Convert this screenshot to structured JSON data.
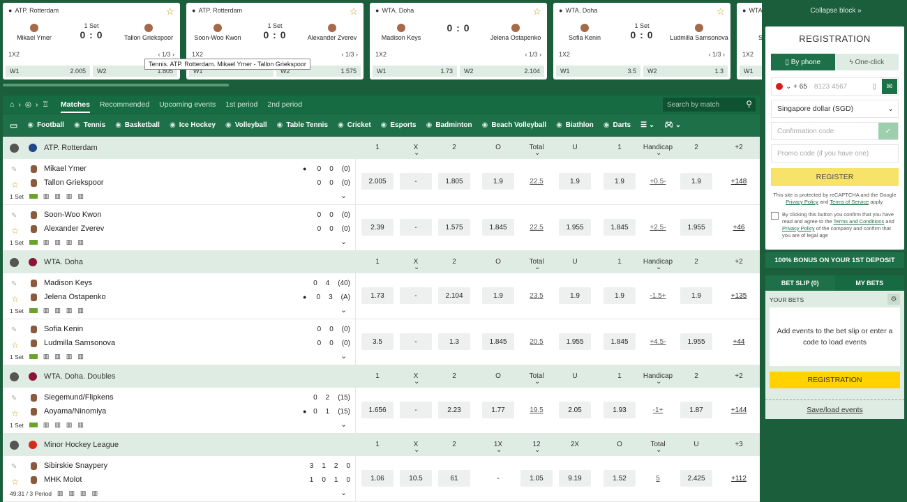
{
  "top_cards": [
    {
      "league": "ATP. Rotterdam",
      "team1": "Mikael Ymer",
      "team2": "Tallon Griekspoor",
      "set": "1 Set",
      "score": "0 : 0",
      "market": "1X2",
      "pager": "1/3",
      "w1": "W1",
      "o1": "2.005",
      "w2": "W2",
      "o2": "1.805"
    },
    {
      "league": "ATP. Rotterdam",
      "team1": "Soon-Woo Kwon",
      "team2": "Alexander Zverev",
      "set": "1 Set",
      "score": "0 : 0",
      "market": "1X2",
      "pager": "1/3",
      "w1": "W1",
      "o1": "",
      "w2": "W2",
      "o2": "1.575"
    },
    {
      "league": "WTA. Doha",
      "team1": "Madison Keys",
      "team2": "Jelena Ostapenko",
      "set": "",
      "score": "0 : 0",
      "market": "1X2",
      "pager": "1/3",
      "w1": "W1",
      "o1": "1.73",
      "w2": "W2",
      "o2": "2.104"
    },
    {
      "league": "WTA. Doha",
      "team1": "Sofia Kenin",
      "team2": "Ludmilla Samsonova",
      "set": "1 Set",
      "score": "0 : 0",
      "market": "1X2",
      "pager": "1/3",
      "w1": "W1",
      "o1": "3.5",
      "w2": "W2",
      "o2": "1.3"
    },
    {
      "league": "WTA",
      "team1": "Siegen",
      "team2": "",
      "set": "",
      "score": "",
      "market": "1X2",
      "pager": "",
      "w1": "W1",
      "o1": "",
      "w2": "",
      "o2": ""
    }
  ],
  "tooltip": "Tennis. ATP. Rotterdam. Mikael Ymer - Tallon Griekspoor",
  "nav": {
    "tabs": [
      "Matches",
      "Recommended",
      "Upcoming events",
      "1st period",
      "2nd period"
    ],
    "search_placeholder": "Search by match"
  },
  "sports": [
    "Football",
    "Tennis",
    "Basketball",
    "Ice Hockey",
    "Volleyball",
    "Table Tennis",
    "Cricket",
    "Esports",
    "Badminton",
    "Beach Volleyball",
    "Biathlon",
    "Darts"
  ],
  "leagues": [
    {
      "name": "ATP. Rotterdam",
      "flag_color": "#21468b",
      "cols": [
        "1",
        "X",
        "2",
        "O",
        "Total",
        "U",
        "1",
        "Handicap",
        "2",
        "+2"
      ],
      "matches": [
        {
          "t1": "Mikael Ymer",
          "t2": "Tallon Griekspoor",
          "s1": [
            "0",
            "0",
            "(0)"
          ],
          "s2": [
            "0",
            "0",
            "(0)"
          ],
          "serve": 1,
          "period": "1 Set",
          "odds": [
            "2.005",
            "-",
            "1.805",
            "1.9",
            "22.5",
            "1.9",
            "1.9",
            "+0.5-",
            "1.9"
          ],
          "more": "+148"
        },
        {
          "t1": "Soon-Woo Kwon",
          "t2": "Alexander Zverev",
          "s1": [
            "0",
            "0",
            "(0)"
          ],
          "s2": [
            "0",
            "0",
            "(0)"
          ],
          "serve": 0,
          "period": "1 Set",
          "odds": [
            "2.39",
            "-",
            "1.575",
            "1.845",
            "22.5",
            "1.955",
            "1.845",
            "+2.5-",
            "1.955"
          ],
          "more": "+46"
        }
      ]
    },
    {
      "name": "WTA. Doha",
      "flag_color": "#8a1538",
      "cols": [
        "1",
        "X",
        "2",
        "O",
        "Total",
        "U",
        "1",
        "Handicap",
        "2",
        "+2"
      ],
      "matches": [
        {
          "t1": "Madison Keys",
          "t2": "Jelena Ostapenko",
          "s1": [
            "0",
            "4",
            "(40)"
          ],
          "s2": [
            "0",
            "3",
            "(A)"
          ],
          "serve": 2,
          "period": "1 Set",
          "odds": [
            "1.73",
            "-",
            "2.104",
            "1.9",
            "23.5",
            "1.9",
            "1.9",
            "-1.5+",
            "1.9"
          ],
          "more": "+135"
        },
        {
          "t1": "Sofia Kenin",
          "t2": "Ludmilla Samsonova",
          "s1": [
            "0",
            "0",
            "(0)"
          ],
          "s2": [
            "0",
            "0",
            "(0)"
          ],
          "serve": 0,
          "period": "1 Set",
          "odds": [
            "3.5",
            "-",
            "1.3",
            "1.845",
            "20.5",
            "1.955",
            "1.845",
            "+4.5-",
            "1.955"
          ],
          "more": "+44"
        }
      ]
    },
    {
      "name": "WTA. Doha. Doubles",
      "flag_color": "#8a1538",
      "cols": [
        "1",
        "X",
        "2",
        "O",
        "Total",
        "U",
        "1",
        "Handicap",
        "2",
        "+2"
      ],
      "matches": [
        {
          "t1": "Siegemund/Flipkens",
          "t2": "Aoyama/Ninomiya",
          "s1": [
            "0",
            "2",
            "(15)"
          ],
          "s2": [
            "0",
            "1",
            "(15)"
          ],
          "serve": 2,
          "period": "1 Set",
          "odds": [
            "1.656",
            "-",
            "2.23",
            "1.77",
            "19.5",
            "2.05",
            "1.93",
            "-1+",
            "1.87"
          ],
          "more": "+144"
        }
      ]
    },
    {
      "name": "Minor Hockey League",
      "flag_color": "#d52b1e",
      "cols": [
        "1",
        "X",
        "2",
        "1X",
        "12",
        "2X",
        "O",
        "Total",
        "U",
        "+3"
      ],
      "matches": [
        {
          "t1": "Sibirskie Snaypery",
          "t2": "MHK Molot",
          "s1": [
            "3",
            "1",
            "2",
            "0"
          ],
          "s2": [
            "1",
            "0",
            "1",
            "0"
          ],
          "serve": 0,
          "period": "49:31 / 3 Period",
          "odds": [
            "1.06",
            "10.5",
            "61",
            "-",
            "1.05",
            "9.19",
            "1.52",
            "5",
            "2.425"
          ],
          "more": "+112"
        }
      ]
    }
  ],
  "panel": {
    "collapse": "Collapse block »",
    "title": "REGISTRATION",
    "tab_phone": "By phone",
    "tab_oneclick": "One-click",
    "dial_code": "+ 65",
    "phone_placeholder": "8123 4567",
    "currency": "Singapore dollar (SGD)",
    "confirm_placeholder": "Confirmation code",
    "promo_placeholder": "Promo code (if you have one)",
    "register": "REGISTER",
    "recaptcha_a": "This site is protected by reCAPTCHA and the Google ",
    "privacy": "Privacy Policy",
    "and": " and ",
    "terms": "Terms of Service",
    "applies": " apply.",
    "consent_a": "By clicking this button you confirm that you have read and agree to the ",
    "consent_terms": "Terms and Conditions",
    "consent_and": " and ",
    "consent_privacy": "Privacy Policy",
    "consent_b": " of the company and confirm that you are of legal age",
    "bonus": "100% BONUS ON YOUR 1ST DEPOSIT",
    "betslip": "BET SLIP (0)",
    "mybets": "MY BETS",
    "yourbets": "YOUR BETS",
    "empty": "Add events to the bet slip or enter a code to load events",
    "registration_btn": "REGISTRATION",
    "saveload": "Save/load events"
  }
}
